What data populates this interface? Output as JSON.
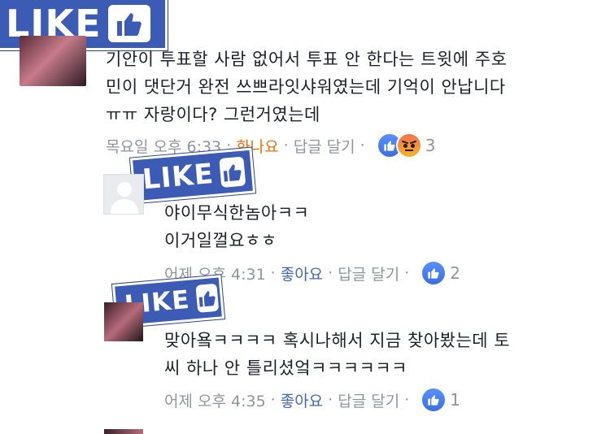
{
  "badges": {
    "like_text": "LIKE"
  },
  "comments": [
    {
      "text_lines": [
        "기안이 투표할 사람 없어서 투표 안 한다는 트윗에 주호",
        "민이 댓단거 완전 쓰쁘라잇샤워였는데 기억이 안납니다",
        "ㅠㅠ 자랑이다? 그런거였는데"
      ],
      "time": "목요일 오후 6:33",
      "reaction": "화나요",
      "reply": "답글 달기",
      "count": "3"
    },
    {
      "text_lines": [
        "야이무식한놈아ㅋㅋ",
        "이거일껄요ㅎㅎ"
      ],
      "time": "어제 오후 4:31",
      "reaction": "좋아요",
      "reply": "답글 달기",
      "count": "2"
    },
    {
      "text_lines": [
        "맞아욬ㅋㅋㅋㅋ 혹시나해서 지금 찾아봤는데 토",
        "씨 하나 안 틀리셨엌ㅋㅋㅋㅋㅋㅋ"
      ],
      "time": "어제 오후 4:35",
      "reaction": "좋아요",
      "reply": "답글 달기",
      "count": "1"
    }
  ],
  "separator": "·"
}
